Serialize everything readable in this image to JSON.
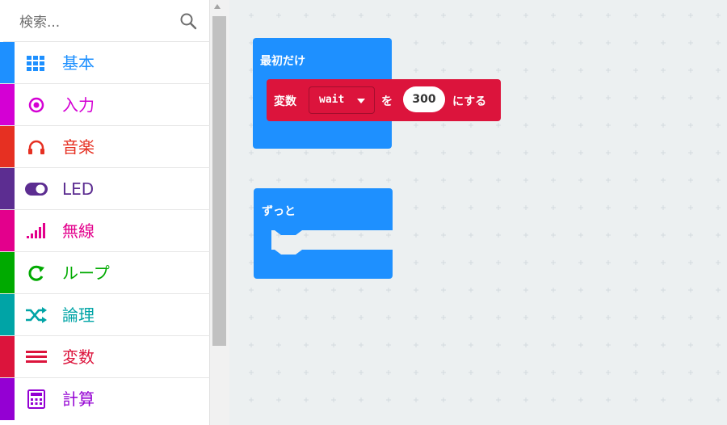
{
  "search": {
    "placeholder": "検索..."
  },
  "categories": [
    {
      "label": "基本",
      "color": "#1e90ff",
      "icon": "grid-icon"
    },
    {
      "label": "入力",
      "color": "#d400d4",
      "icon": "target-icon"
    },
    {
      "label": "音楽",
      "color": "#e63022",
      "icon": "headphones-icon"
    },
    {
      "label": "LED",
      "color": "#5c2d91",
      "icon": "toggle-icon"
    },
    {
      "label": "無線",
      "color": "#e3008c",
      "icon": "signal-icon"
    },
    {
      "label": "ループ",
      "color": "#00aa00",
      "icon": "loop-icon"
    },
    {
      "label": "論理",
      "color": "#00a4a6",
      "icon": "shuffle-icon"
    },
    {
      "label": "変数",
      "color": "#dc143c",
      "icon": "lines-icon"
    },
    {
      "label": "計算",
      "color": "#9400d3",
      "icon": "calculator-icon"
    }
  ],
  "workspace": {
    "on_start": {
      "title": "最初だけ"
    },
    "set_block": {
      "word1": "変数",
      "variable": "wait",
      "word2": "を",
      "value": "300",
      "word3": "にする"
    },
    "forever": {
      "title": "ずっと"
    }
  }
}
